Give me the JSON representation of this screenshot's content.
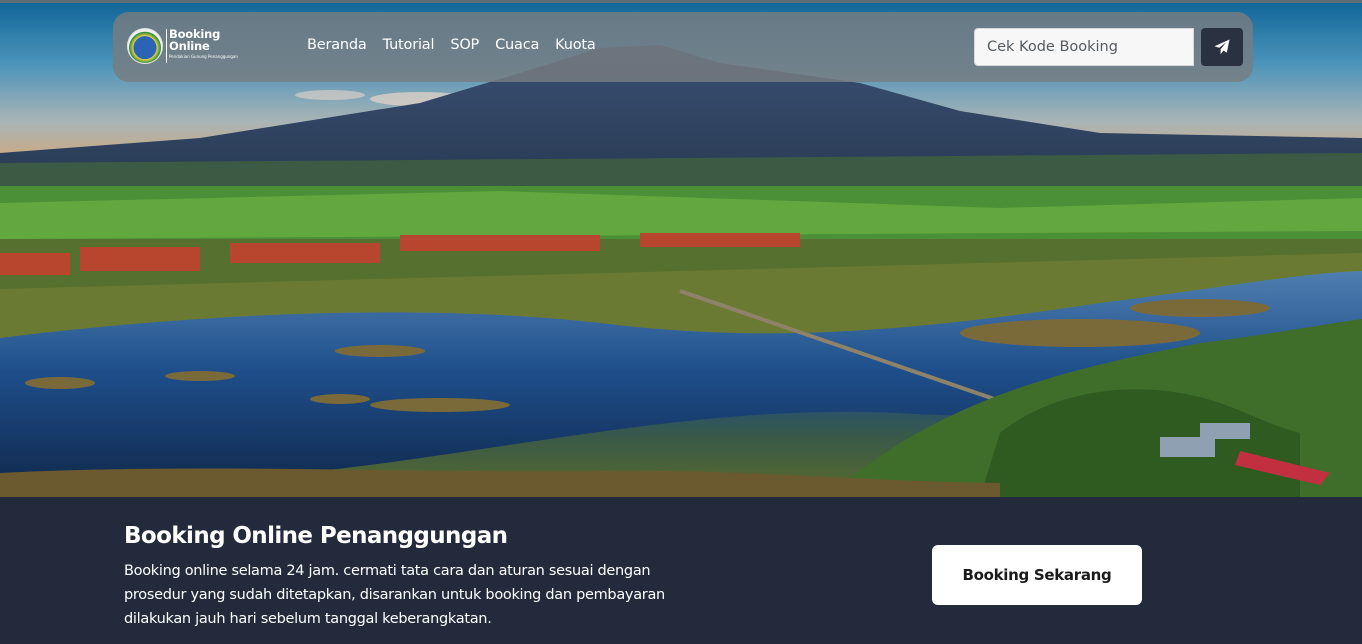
{
  "logo": {
    "line1": "Booking",
    "line2": "Online",
    "line3": "Pendakian Gunung Penanggungan"
  },
  "nav": {
    "items": [
      {
        "label": "Beranda"
      },
      {
        "label": "Tutorial"
      },
      {
        "label": "SOP"
      },
      {
        "label": "Cuaca"
      },
      {
        "label": "Kuota"
      }
    ]
  },
  "search": {
    "placeholder": "Cek Kode Booking",
    "icon": "paper-plane-icon"
  },
  "footer": {
    "title": "Booking Online Penanggungan",
    "description": "Booking online selama 24 jam. cermati tata cara dan aturan sesuai dengan prosedur yang sudah ditetapkan, disarankan untuk booking dan pembayaran dilakukan jauh hari sebelum tanggal keberangkatan.",
    "button_label": "Booking Sekarang"
  },
  "colors": {
    "footer_bg": "#222a3b",
    "navbar_bg": "rgba(120,124,128,0.82)",
    "search_button_bg": "#2a3242"
  }
}
